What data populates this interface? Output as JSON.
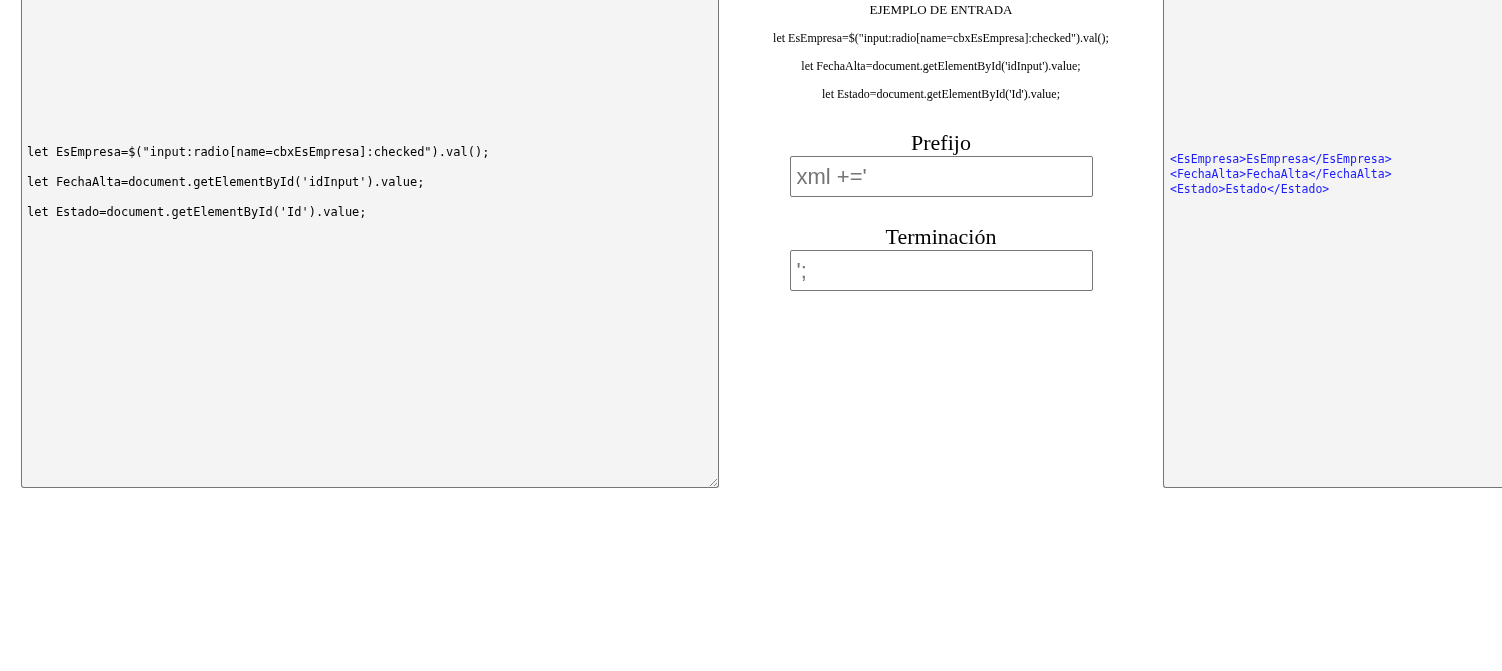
{
  "input_code": {
    "lines": [
      "let EsEmpresa=$(\"input:radio[name=cbxEsEmpresa]:checked\").val();",
      "let FechaAlta=document.getElementById('idInput').value;",
      "let Estado=document.getElementById('Id').value;"
    ]
  },
  "example": {
    "title": "EJEMPLO DE ENTRADA",
    "lines": [
      "let EsEmpresa=$(\"input:radio[name=cbxEsEmpresa]:checked\").val();",
      "let FechaAlta=document.getElementById('idInput').value;",
      "let Estado=document.getElementById('Id').value;"
    ]
  },
  "prefix": {
    "label": "Prefijo",
    "placeholder": "xml +='"
  },
  "termination": {
    "label": "Terminación",
    "placeholder": "';"
  },
  "output_code": {
    "lines": [
      "<EsEmpresa>EsEmpresa</EsEmpresa>",
      "<FechaAlta>FechaAlta</FechaAlta>",
      "<Estado>Estado</Estado>"
    ]
  }
}
